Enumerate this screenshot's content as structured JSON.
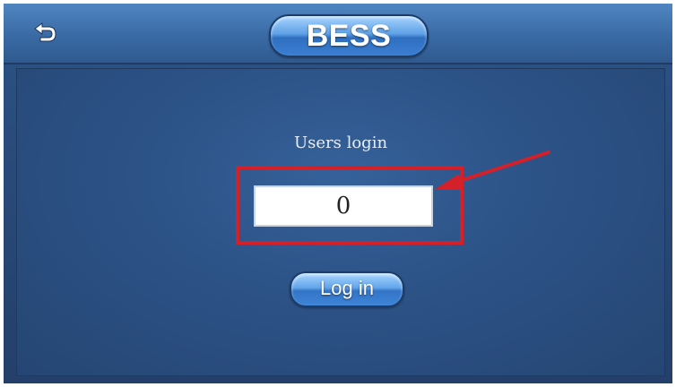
{
  "header": {
    "title": "BESS",
    "back_icon": "back-arrow-icon"
  },
  "login": {
    "label": "Users login",
    "user_field_value": "0",
    "button_label": "Log in"
  },
  "colors": {
    "background": "#2a4f80",
    "header": "#3a6aa4",
    "button": "#4b8fdc",
    "highlight": "#d42028"
  }
}
